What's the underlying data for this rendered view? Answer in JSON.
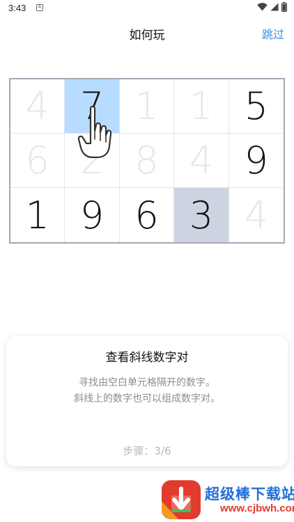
{
  "status_bar": {
    "time": "3:43",
    "notification_icon": "A"
  },
  "header": {
    "title": "如何玩",
    "skip_label": "跳过"
  },
  "grid": {
    "rows": [
      [
        {
          "value": "4",
          "faded": true,
          "highlight": "none"
        },
        {
          "value": "7",
          "faded": false,
          "highlight": "blue"
        },
        {
          "value": "1",
          "faded": true,
          "highlight": "none"
        },
        {
          "value": "1",
          "faded": true,
          "highlight": "none"
        },
        {
          "value": "5",
          "faded": false,
          "highlight": "none"
        }
      ],
      [
        {
          "value": "6",
          "faded": true,
          "highlight": "none"
        },
        {
          "value": "2",
          "faded": true,
          "highlight": "none"
        },
        {
          "value": "8",
          "faded": true,
          "highlight": "none"
        },
        {
          "value": "4",
          "faded": true,
          "highlight": "none"
        },
        {
          "value": "9",
          "faded": false,
          "highlight": "none"
        }
      ],
      [
        {
          "value": "1",
          "faded": false,
          "highlight": "none"
        },
        {
          "value": "9",
          "faded": false,
          "highlight": "none"
        },
        {
          "value": "6",
          "faded": false,
          "highlight": "none"
        },
        {
          "value": "3",
          "faded": false,
          "highlight": "gray"
        },
        {
          "value": "4",
          "faded": true,
          "highlight": "none"
        }
      ]
    ]
  },
  "tutorial": {
    "title": "查看斜线数字对",
    "line1": "寻找由空白单元格隔开的数字。",
    "line2": "斜线上的数字也可以组成数字对。",
    "step_label": "步骤：3/6"
  },
  "watermark": {
    "brand": "超级棒下载站",
    "url": "www.cjbwh.com"
  },
  "colors": {
    "accent": "#3d8fe0",
    "highlight_blue": "#b7dcff",
    "highlight_gray": "#cdd3e0",
    "faded_digit": "#e6e7ea",
    "brand_red": "#e23a2c",
    "brand_blue": "#1f6fd8"
  },
  "icons": {
    "wifi": "wifi-icon",
    "cell_signal": "cell-signal-icon",
    "battery": "battery-icon",
    "hand": "hand-pointer-icon"
  }
}
